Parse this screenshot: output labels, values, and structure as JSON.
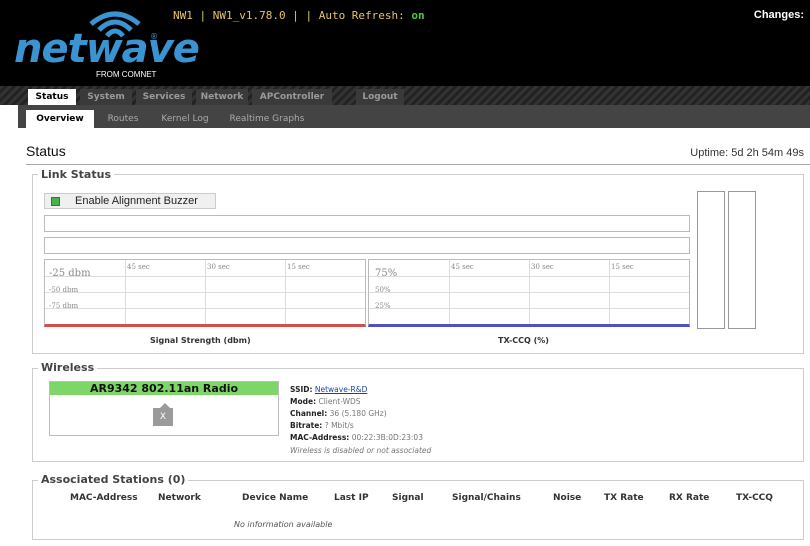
{
  "header": {
    "logo_text": "netwave",
    "logo_sub": "FROM COMNET",
    "status_prefix": "NW1 | NW1_v1.78.0 | | Auto Refresh: ",
    "auto_refresh_state": "on",
    "changes_label": "Changes:"
  },
  "main_tabs": [
    "Status",
    "System",
    "Services",
    "Network",
    "APController",
    "Logout"
  ],
  "sub_tabs": [
    "Overview",
    "Routes",
    "Kernel Log",
    "Realtime Graphs"
  ],
  "page": {
    "title": "Status",
    "uptime": "Uptime: 5d 2h 54m 49s"
  },
  "link_status": {
    "legend": "Link Status",
    "buzzer_button": "Enable Alignment Buzzer",
    "signal_graph": {
      "ticks": [
        "45 sec",
        "30 sec",
        "15 sec"
      ],
      "current": "-25 dbm",
      "levels": [
        "-50 dbm",
        "-75 dbm"
      ],
      "caption": "Signal Strength (dbm)"
    },
    "txccq_graph": {
      "ticks": [
        "45 sec",
        "30 sec",
        "15 sec"
      ],
      "current": "75%",
      "levels": [
        "50%",
        "25%"
      ],
      "caption": "TX-CCQ (%)"
    }
  },
  "wireless": {
    "legend": "Wireless",
    "radio_name": "AR9342 802.11an Radio",
    "x_label": "X",
    "ssid_label": "SSID:",
    "ssid_value": "Netwave-R&D",
    "mode_label": "Mode:",
    "mode_value": "Client-WDS",
    "channel_label": "Channel:",
    "channel_value": "36 (5.180 GHz)",
    "bitrate_label": "Bitrate:",
    "bitrate_value": "? Mbit/s",
    "mac_label": "MAC-Address:",
    "mac_value": "00:22:3B:0D:23:03",
    "status_note_a": "Wireless is disabled",
    "status_note_mid": "or",
    "status_note_b": "not associated"
  },
  "stations": {
    "legend": "Associated Stations (0)",
    "columns": [
      "MAC-Address",
      "Network",
      "Device Name",
      "Last IP",
      "Signal",
      "Signal/Chains",
      "Noise",
      "TX Rate",
      "RX Rate",
      "TX-CCQ"
    ],
    "empty_text": "No information available"
  },
  "colors": {
    "accent": "#3b94d2",
    "on": "#4ccc3c",
    "radio_header": "#7ed669",
    "signal_line": "#d05050",
    "ccq_line": "#5050c0"
  }
}
